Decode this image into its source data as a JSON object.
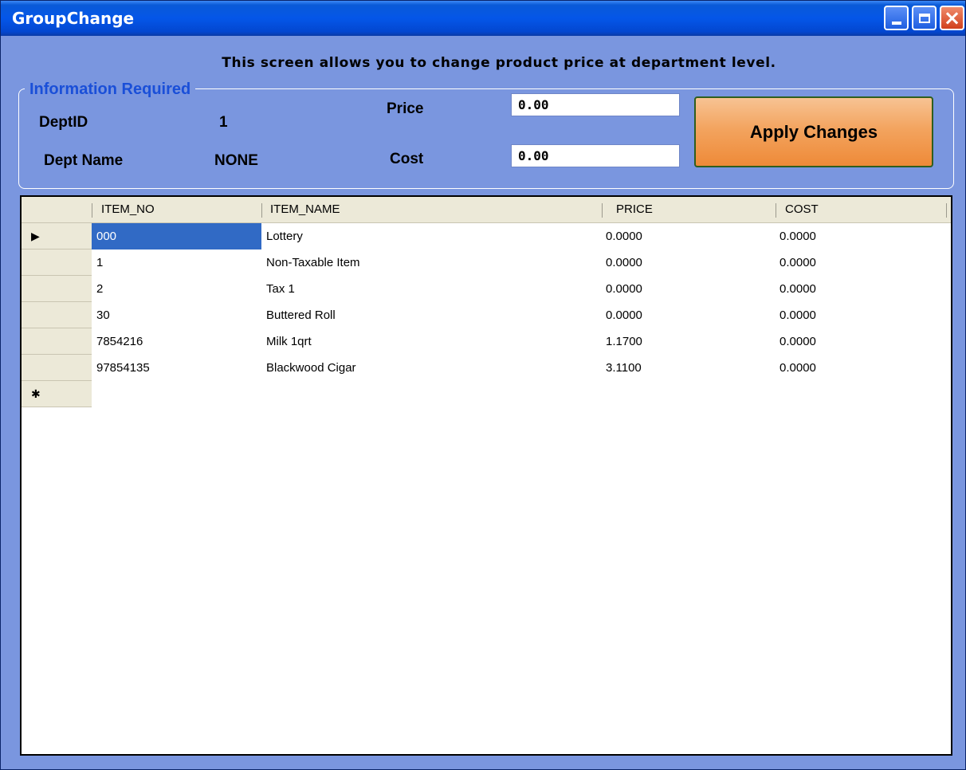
{
  "window": {
    "title": "GroupChange"
  },
  "instruction": "This screen allows you to change product price at department level.",
  "info": {
    "legend": "Information Required",
    "dept_id_label": "DeptID",
    "dept_id_value": "1",
    "dept_name_label": "Dept Name",
    "dept_name_value": "NONE",
    "price_label": "Price",
    "price_value": "0.00",
    "cost_label": "Cost",
    "cost_value": "0.00",
    "apply_label": "Apply Changes"
  },
  "grid": {
    "columns": [
      "ITEM_NO",
      "ITEM_NAME",
      "PRICE",
      "COST"
    ],
    "rows": [
      [
        "000",
        "Lottery",
        "0.0000",
        "0.0000"
      ],
      [
        "1",
        "Non-Taxable Item",
        "0.0000",
        "0.0000"
      ],
      [
        "2",
        "Tax 1",
        "0.0000",
        "0.0000"
      ],
      [
        "30",
        "Buttered Roll",
        "0.0000",
        "0.0000"
      ],
      [
        "7854216",
        "Milk 1qrt",
        "1.1700",
        "0.0000"
      ],
      [
        "97854135",
        "Blackwood Cigar",
        "3.1100",
        "0.0000"
      ]
    ],
    "current_row_marker": "▶",
    "new_row_marker": "✱"
  },
  "colors": {
    "window_bg": "#7a96df",
    "title_bar": "#0456e8",
    "selection": "#316ac5",
    "legend_text": "#1a4fd8",
    "apply_button": "#f3a45f"
  }
}
